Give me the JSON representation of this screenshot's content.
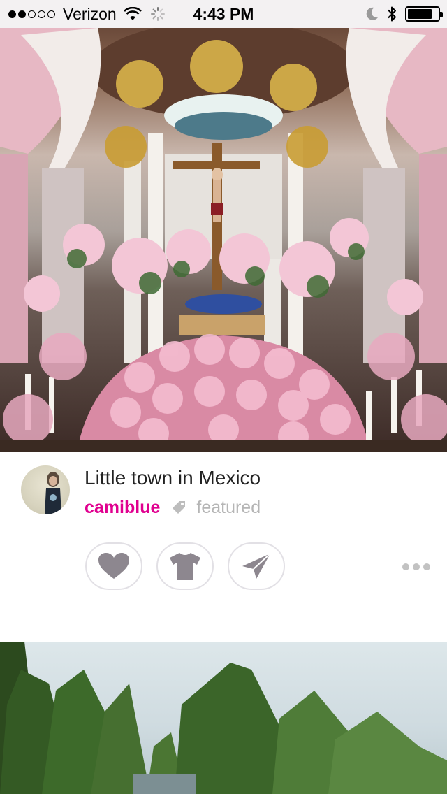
{
  "status_bar": {
    "carrier": "Verizon",
    "time": "4:43 PM",
    "signal_bars_filled": 2,
    "signal_bars_total": 5,
    "battery_level": 0.8,
    "icons": [
      "wifi-icon",
      "activity-spinner-icon",
      "do-not-disturb-moon-icon",
      "bluetooth-icon",
      "battery-icon"
    ]
  },
  "post": {
    "photo_subject": "altar",
    "title": "Little town in Mexico",
    "username": "camiblue",
    "tag": "featured",
    "avatar_icon": "user-avatar",
    "actions": [
      {
        "name": "like",
        "icon": "heart-icon"
      },
      {
        "name": "shirt",
        "icon": "tshirt-icon"
      },
      {
        "name": "share",
        "icon": "paper-plane-icon"
      }
    ],
    "more_icon": "more-dots-icon"
  },
  "colors": {
    "username": "#e0008f",
    "tag_text": "#b5b5b5",
    "icon_fill": "#8d878f",
    "button_border": "#e2e0e5",
    "status_bar_bg": "#f3f1f2"
  }
}
